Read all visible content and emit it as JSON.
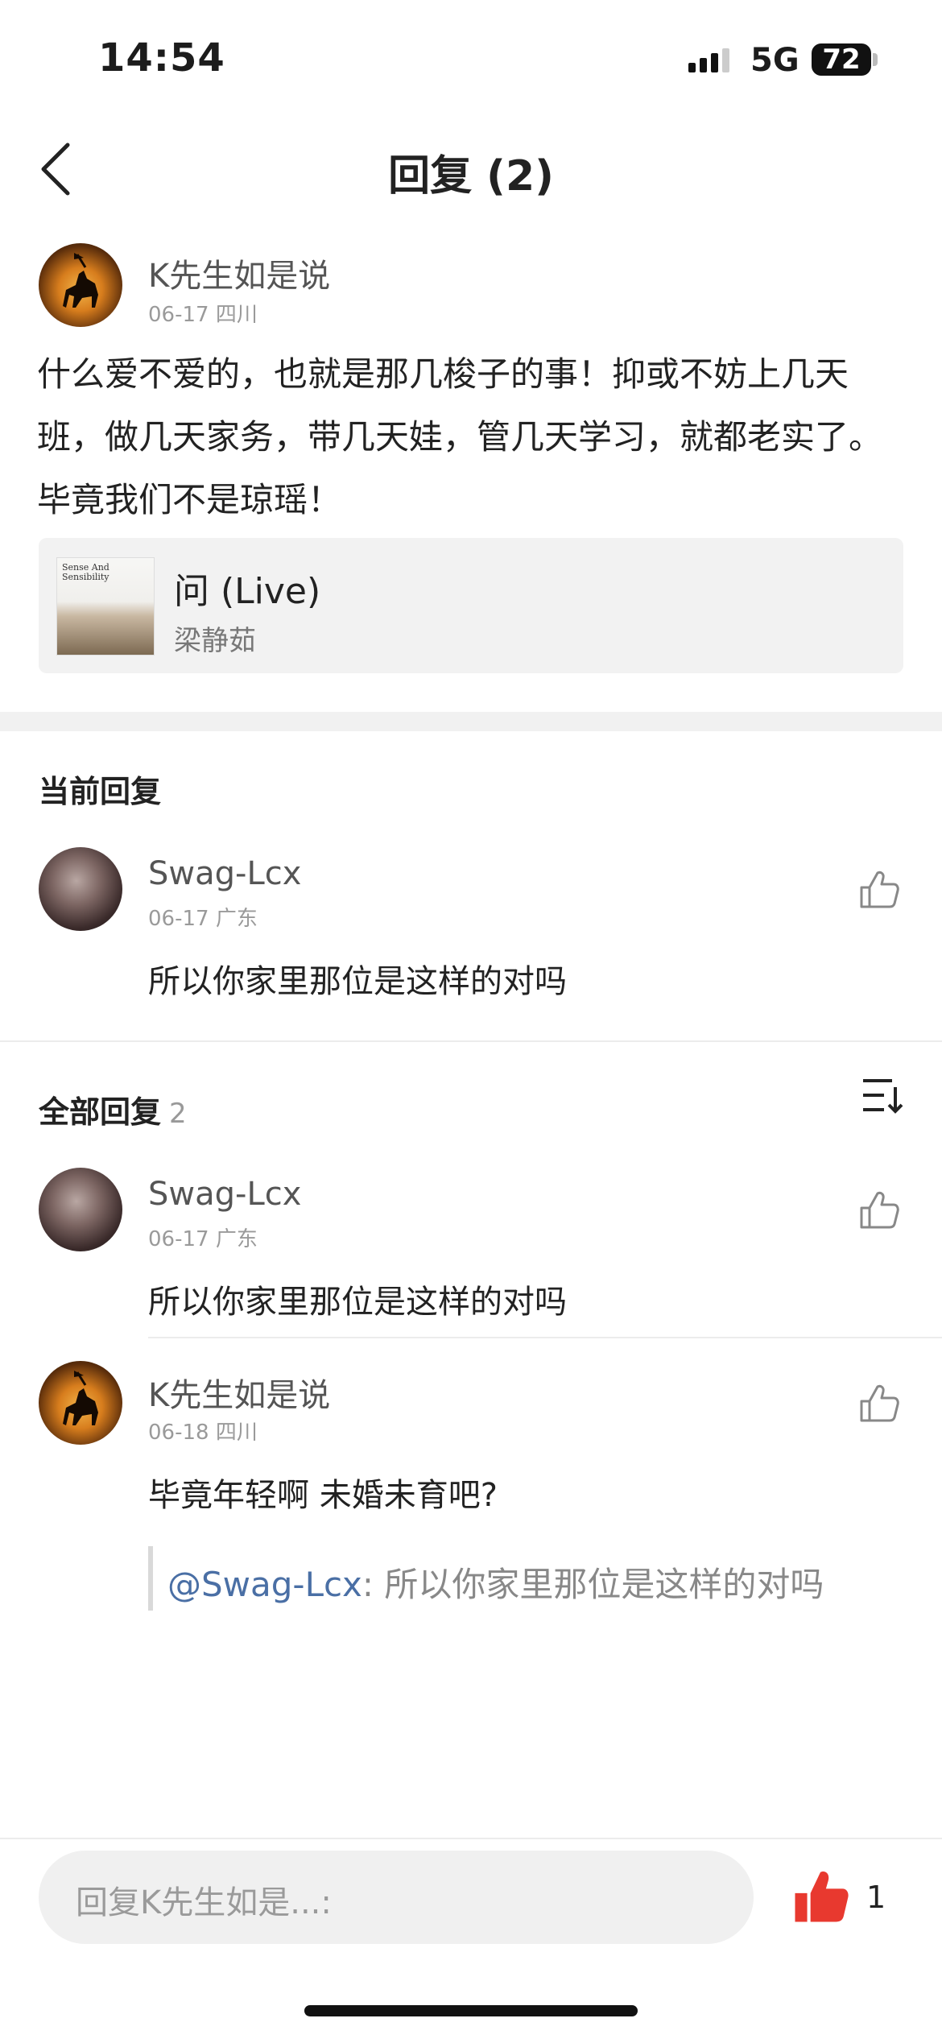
{
  "status_bar": {
    "time": "14:54",
    "network": "5G",
    "battery": "72"
  },
  "header": {
    "title": "回复 (2)"
  },
  "post": {
    "author": "K先生如是说",
    "meta": "06-17 四川",
    "text": "什么爱不爱的，也就是那几梭子的事！抑或不妨上几天班，做几天家务，带几天娃，管几天学习，就都老实了。毕竟我们不是琼瑶！",
    "music": {
      "title": "问 (Live)",
      "artist": "梁静茹",
      "cover_text": "Sense And Sensibility"
    }
  },
  "current_reply": {
    "section_title": "当前回复",
    "author": "Swag-Lcx",
    "meta": "06-17 广东",
    "text": "所以你家里那位是这样的对吗"
  },
  "all_replies": {
    "section_title": "全部回复",
    "count": "2",
    "items": [
      {
        "author": "Swag-Lcx",
        "meta": "06-17 广东",
        "text": "所以你家里那位是这样的对吗"
      },
      {
        "author": "K先生如是说",
        "meta": "06-18 四川",
        "text": "毕竟年轻啊 未婚未育吧?",
        "quote_user": "@Swag-Lcx",
        "quote_text": ": 所以你家里那位是这样的对吗"
      }
    ]
  },
  "bottom_bar": {
    "placeholder": "回复K先生如是...:",
    "like_count": "1"
  },
  "colors": {
    "like_red": "#e8392f",
    "link_blue": "#4a6fa5",
    "gap_gray": "#f1f1f1"
  }
}
